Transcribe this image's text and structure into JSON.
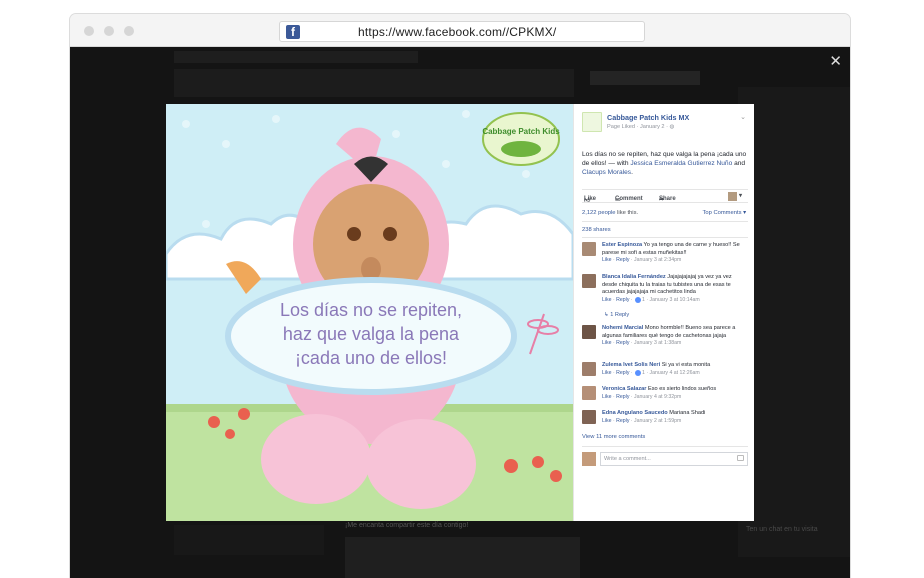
{
  "browser": {
    "url": "https://www.facebook.com//CPKMX/",
    "favicon_letter": "f"
  },
  "background_page": {
    "caption": "¡Me encanta compartir este día contigo!",
    "sidebar_text": "Ten un chat en tu visita"
  },
  "photo": {
    "caption_lines": [
      "Los días no se repiten,",
      "haz que valga la pena",
      "¡cada uno de ellos!"
    ],
    "logo_text": "Cabbage Patch Kids"
  },
  "post": {
    "page_name": "Cabbage Patch Kids MX",
    "meta": "Page Liked · January 2 · ",
    "text_main": "Los días no se repiten, haz que valga la pena ¡cada uno de ellos! — with ",
    "tag1": "Jessica Esmeralda Gutierrez Nuño",
    "text_and": " and ",
    "tag2": "Clacups Morales",
    "text_end": ".",
    "actions": {
      "like": "Like",
      "comment": "Comment",
      "share": "Share"
    },
    "likes_count": "2,122 people",
    "likes_suffix": " like this.",
    "top_comments": "Top Comments ▾",
    "shares": "238 shares"
  },
  "comments": [
    {
      "author": "Ester Espinoza",
      "text": " Yo ya tengo una de carne y hueso!! Se parese mi sofi a estas muñekitas!!",
      "meta": "· January 3 at 2:34pm",
      "likes": ""
    },
    {
      "author": "Blanca Idalia Fernández",
      "text": " Jajajajajajaj ya vez ya vez desde chiquita tu la traias tu tubistes una de esas te acuerdas jajajajaja mi cachetitos linda",
      "meta": "· January 3 at 10:14am",
      "likes": "1"
    },
    {
      "author": "Nohemi Marcial",
      "text": " Mono hormble!! Bueno sea parece a algunas familiares qué tengo de cachetonas jajaja",
      "meta": "· January 3 at 1:38am",
      "likes": ""
    },
    {
      "author": "Zulema Ivet Solis Neri",
      "text": " Si ya vi esta monita",
      "meta": "· January 4 at 12:26am",
      "likes": "1"
    },
    {
      "author": "Veronica Salazar",
      "text": " Eso es sierto lindos sueños",
      "meta": "· January 4 at 9:32pm",
      "likes": ""
    },
    {
      "author": "Edna Angulano Saucedo",
      "text": " Mariana Shadi",
      "meta": "· January 2 at 1:59pm",
      "likes": ""
    }
  ],
  "ui": {
    "like_link": "Like",
    "reply_link": "Reply",
    "one_reply": "↳ 1 Reply",
    "view_more": "View 11 more comments",
    "write_placeholder": "Write a comment...",
    "close": "✕"
  },
  "colors": {
    "facebook_blue": "#3b5998",
    "link_blue": "#365899",
    "sky": "#cfeef6",
    "doll_pink": "#f4b7cf",
    "grass": "#bfe3a0",
    "caption_purple": "#8a78b8"
  }
}
